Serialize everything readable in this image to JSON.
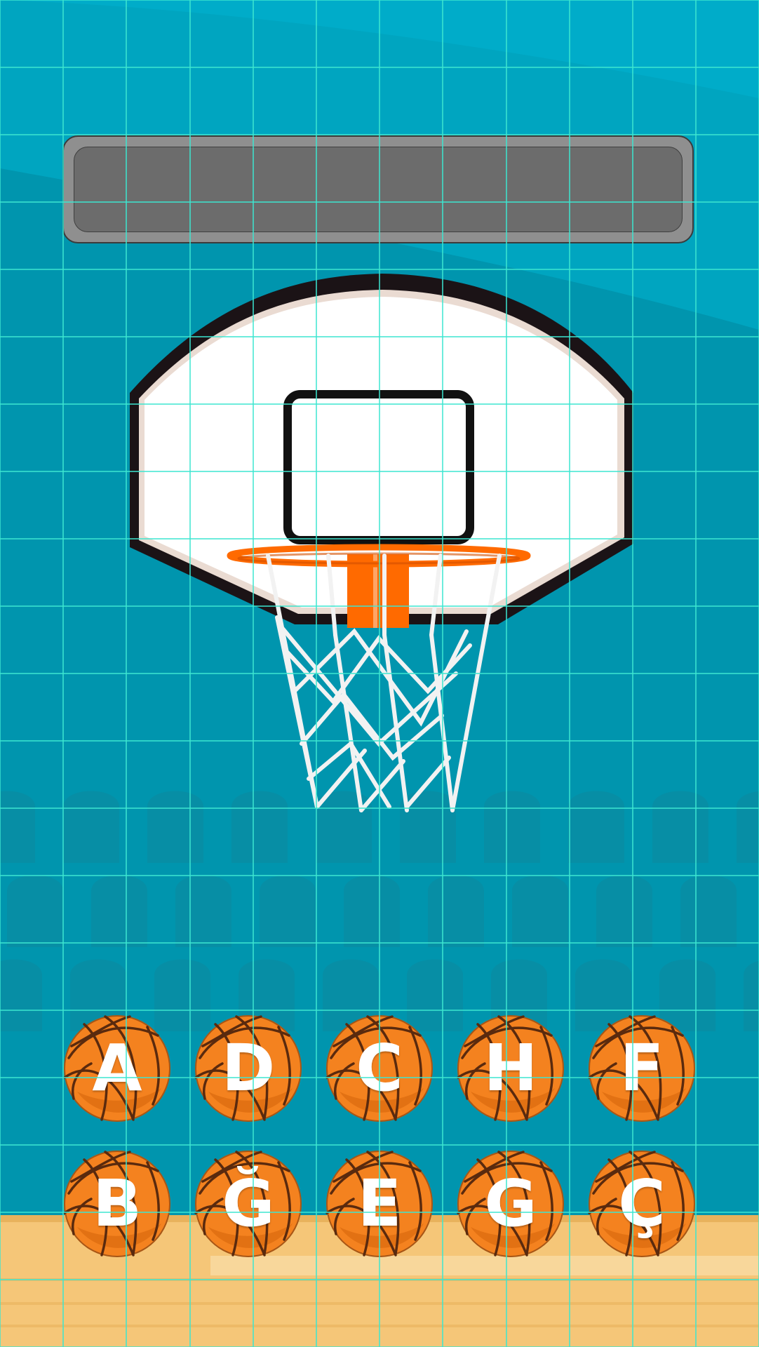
{
  "colors": {
    "sky": "#00a8c4",
    "wall": "#0094ad",
    "crowd": "#0a8aa0",
    "floor": "#f5c678",
    "floor_dark": "#e8b25c",
    "ball": "#f4821f",
    "ball_shade": "#dd6d10",
    "ball_lines": "#5a2a0e",
    "rim": "#ff6a00",
    "grid_line": "#3de6d0"
  },
  "scoreboard": {
    "answer": ""
  },
  "balls": [
    {
      "letter": "A"
    },
    {
      "letter": "D"
    },
    {
      "letter": "C"
    },
    {
      "letter": "H"
    },
    {
      "letter": "F"
    },
    {
      "letter": "B"
    },
    {
      "letter": "Ğ"
    },
    {
      "letter": "E"
    },
    {
      "letter": "G"
    },
    {
      "letter": "Ç"
    }
  ]
}
